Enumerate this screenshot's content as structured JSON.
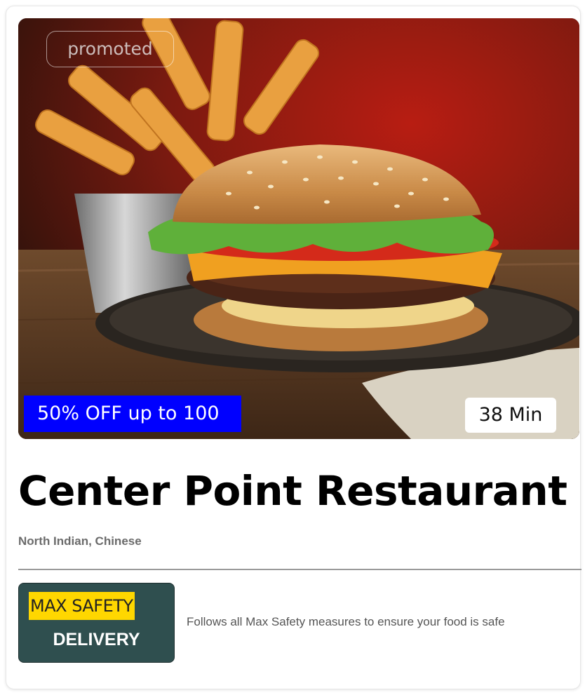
{
  "card": {
    "badge_promoted": "promoted",
    "offer": "50% OFF up to 100",
    "delivery_time": "38 Min",
    "restaurant_name": "Center Point Restaurant",
    "cuisines": "North Indian, Chinese",
    "safety": {
      "label_top": "MAX SAFETY",
      "label_bottom": "DELIVERY",
      "description": "Follows all Max Safety measures to ensure your food is safe"
    }
  },
  "colors": {
    "offer_bg": "#0000ff",
    "safety_bg": "#2f4f4f",
    "safety_highlight": "#ffd700"
  },
  "image": {
    "subject": "burger-and-fries-photo"
  }
}
